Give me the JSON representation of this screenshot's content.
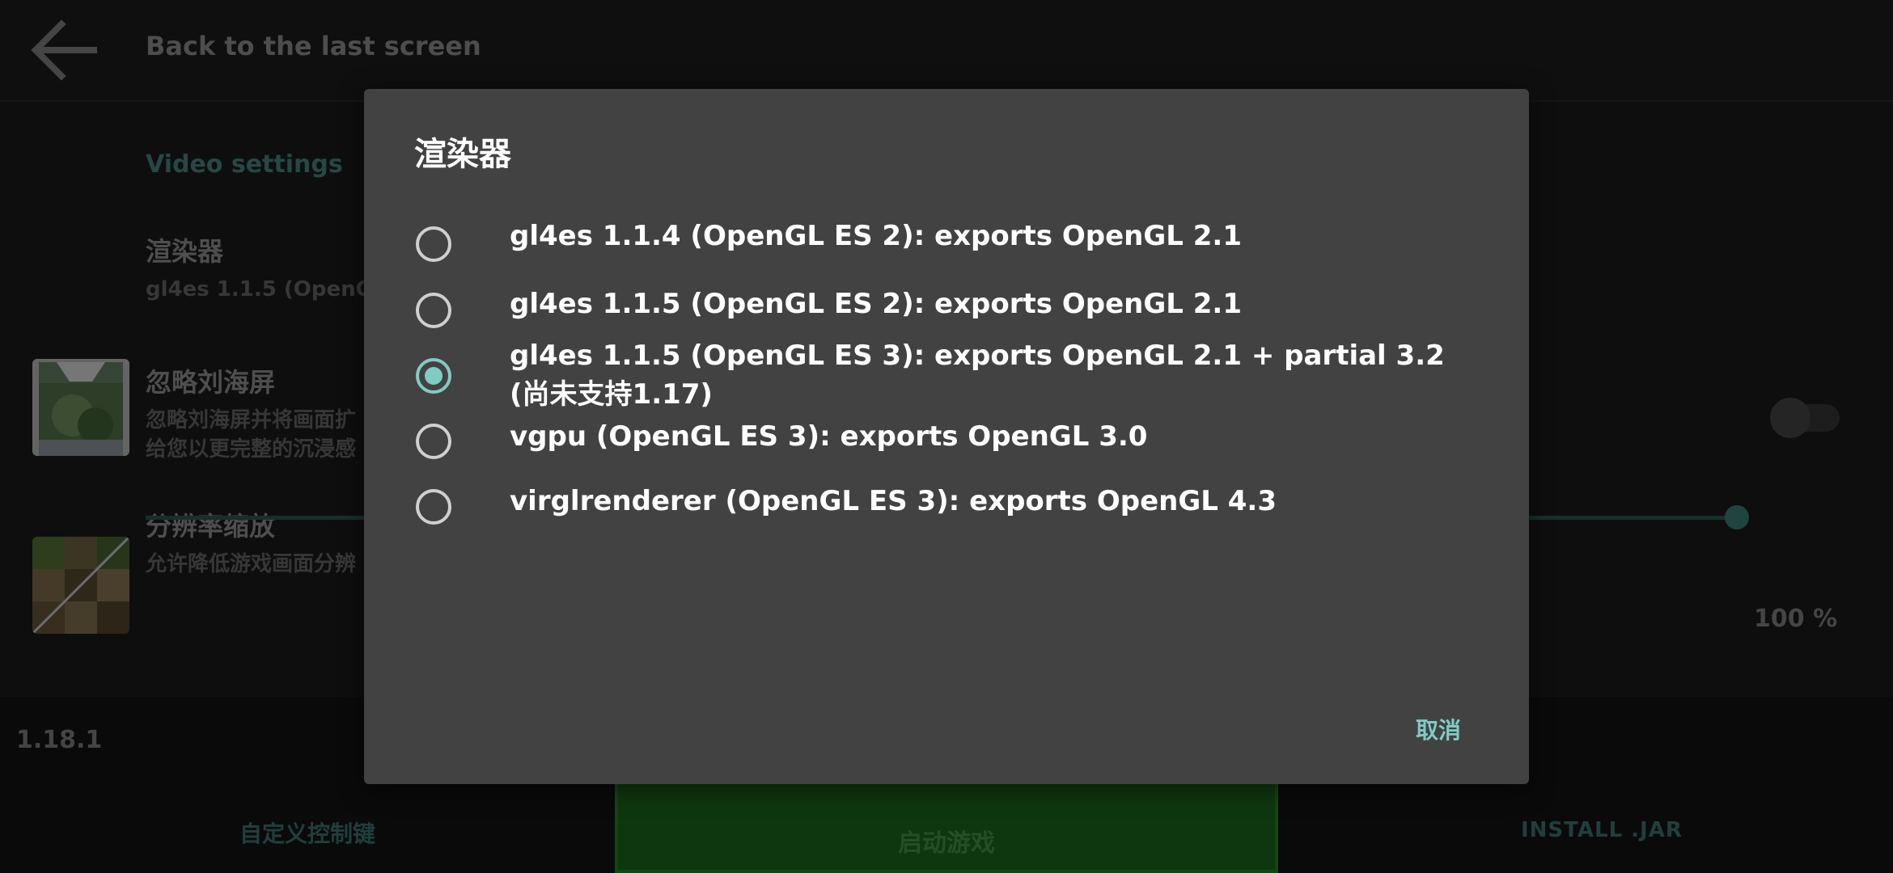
{
  "colors": {
    "accent": "#80cbc4",
    "dialog_bg": "#424242",
    "play_button": "#1e6f1e"
  },
  "top_bar": {
    "back_icon": "arrow-left-icon",
    "back_label": "Back to the last screen"
  },
  "settings": {
    "section_title": "Video settings",
    "renderer": {
      "title": "渲染器",
      "summary": "gl4es 1.1.5 (OpenGL"
    },
    "ignore_notch": {
      "title": "忽略刘海屏",
      "summary_line1": "忽略刘海屏并将画面扩",
      "summary_line2": "给您以更完整的沉浸感",
      "enabled": false
    },
    "resolution_scale": {
      "title": "分辨率缩放",
      "summary": "允许降低游戏画面分辨",
      "value_label": "100 %",
      "value_percent": 100
    }
  },
  "bottom_bar": {
    "version": "1.18.1",
    "custom_controls": "自定义控制键",
    "play": "启动游戏",
    "install_jar": "INSTALL .JAR"
  },
  "dialog": {
    "title": "渲染器",
    "options": [
      {
        "label": "gl4es 1.1.4 (OpenGL ES 2): exports OpenGL 2.1",
        "checked": false
      },
      {
        "label": "gl4es 1.1.5 (OpenGL ES 2): exports OpenGL 2.1",
        "checked": false
      },
      {
        "label": "gl4es 1.1.5 (OpenGL ES 3): exports OpenGL 2.1 + partial 3.2 (尚未支持1.17)",
        "checked": true
      },
      {
        "label": "vgpu (OpenGL ES 3): exports OpenGL 3.0",
        "checked": false
      },
      {
        "label": "virglrenderer (OpenGL ES 3): exports OpenGL 4.3",
        "checked": false
      }
    ],
    "cancel": "取消"
  }
}
